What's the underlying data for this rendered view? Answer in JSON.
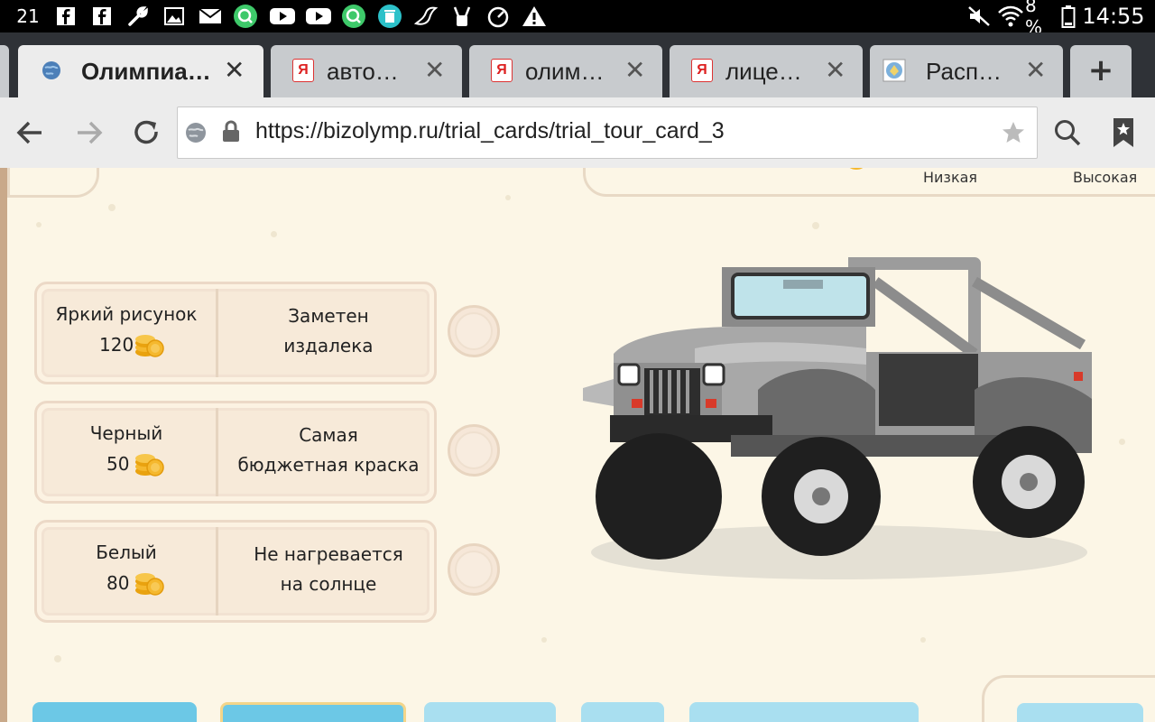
{
  "status_bar": {
    "temperature": "21",
    "battery_percent": "8 %",
    "time": "14:55",
    "icons": [
      "facebook-icon",
      "facebook-icon",
      "wrench-icon",
      "image-icon",
      "mail-icon",
      "search-app-icon",
      "youtube-icon",
      "youtube-icon",
      "search-app-icon",
      "trash-icon",
      "bird-icon",
      "robot-icon",
      "speedometer-icon",
      "warning-icon",
      "mute-icon",
      "wifi-icon",
      "battery-icon"
    ]
  },
  "tabs": [
    {
      "title": "Олимпиа…",
      "favicon": "globe-icon",
      "active": true
    },
    {
      "title": "авто…",
      "favicon": "yandex-icon",
      "active": false
    },
    {
      "title": "олим…",
      "favicon": "yandex-icon",
      "active": false
    },
    {
      "title": "лице…",
      "favicon": "yandex-icon",
      "active": false
    },
    {
      "title": "Расп…",
      "favicon": "emblem-icon",
      "active": false
    }
  ],
  "new_tab_label": "+",
  "toolbar": {
    "url": "https://bizolymp.ru/trial_cards/trial_tour_card_3",
    "yandex_letter": "Я"
  },
  "scale": {
    "low_label": "Низкая",
    "high_label": "Высокая"
  },
  "options": [
    {
      "name": "Яркий рисунок",
      "price": "120",
      "description_line1": "Заметен",
      "description_line2": "издалека"
    },
    {
      "name": "Черный",
      "price": "50",
      "description_line1": "Самая",
      "description_line2": "бюджетная краска"
    },
    {
      "name": "Белый",
      "price": "80",
      "description_line1": "Не нагревается",
      "description_line2": "на солнце"
    }
  ],
  "colors": {
    "page_background": "#fcf6e6",
    "card_border": "#ecd9c7",
    "accent_blue": "#6cc8e6",
    "coin_gold": "#f5b82e"
  }
}
